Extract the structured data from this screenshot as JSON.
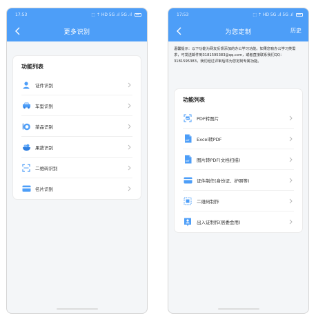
{
  "left_screen": {
    "status": {
      "time": "17:53",
      "icons": "⬚ ⇡ HD 5G .ıl 5G .ıl"
    },
    "title": "更多识别",
    "list_title": "功能列表",
    "items": [
      {
        "label": "证件识别",
        "icon": "person-icon"
      },
      {
        "label": "车型识别",
        "icon": "car-icon"
      },
      {
        "label": "菜品识别",
        "icon": "dish-icon"
      },
      {
        "label": "果蔬识别",
        "icon": "fruit-bowl-icon"
      },
      {
        "label": "二维码识别",
        "icon": "qr-scan-icon"
      },
      {
        "label": "名片识别",
        "icon": "business-card-icon"
      }
    ]
  },
  "right_screen": {
    "status": {
      "time": "17:53",
      "icons": "⬚ ⇡ HD 5G .ıl 5G .ıl"
    },
    "title": "为您定制",
    "action": "历史",
    "notice": "温馨提示：以下功能为网友反馈添加的办公学习功能。如果您有办公学习类需求，可发送邮件到3181595383@qq.com，或者直接联系我们QQ：3181595383，我们经过评审后将为您定制专属功能。",
    "list_title": "功能列表",
    "items": [
      {
        "label": "PDF转图片",
        "icon": "image-icon"
      },
      {
        "label": "Excel转PDF",
        "icon": "pdf-file-icon"
      },
      {
        "label": "图片转PDF(文档扫描)",
        "icon": "pdf-file-icon"
      },
      {
        "label": "证件制作(身份证、护照等)",
        "icon": "id-card-icon"
      },
      {
        "label": "二维码制作",
        "icon": "qr-code-icon"
      },
      {
        "label": "出入证制作(居委会用)",
        "icon": "pass-card-icon"
      }
    ]
  },
  "colors": {
    "accent": "#4d9ef8",
    "background": "#f4f6f8",
    "card": "#ffffff"
  }
}
